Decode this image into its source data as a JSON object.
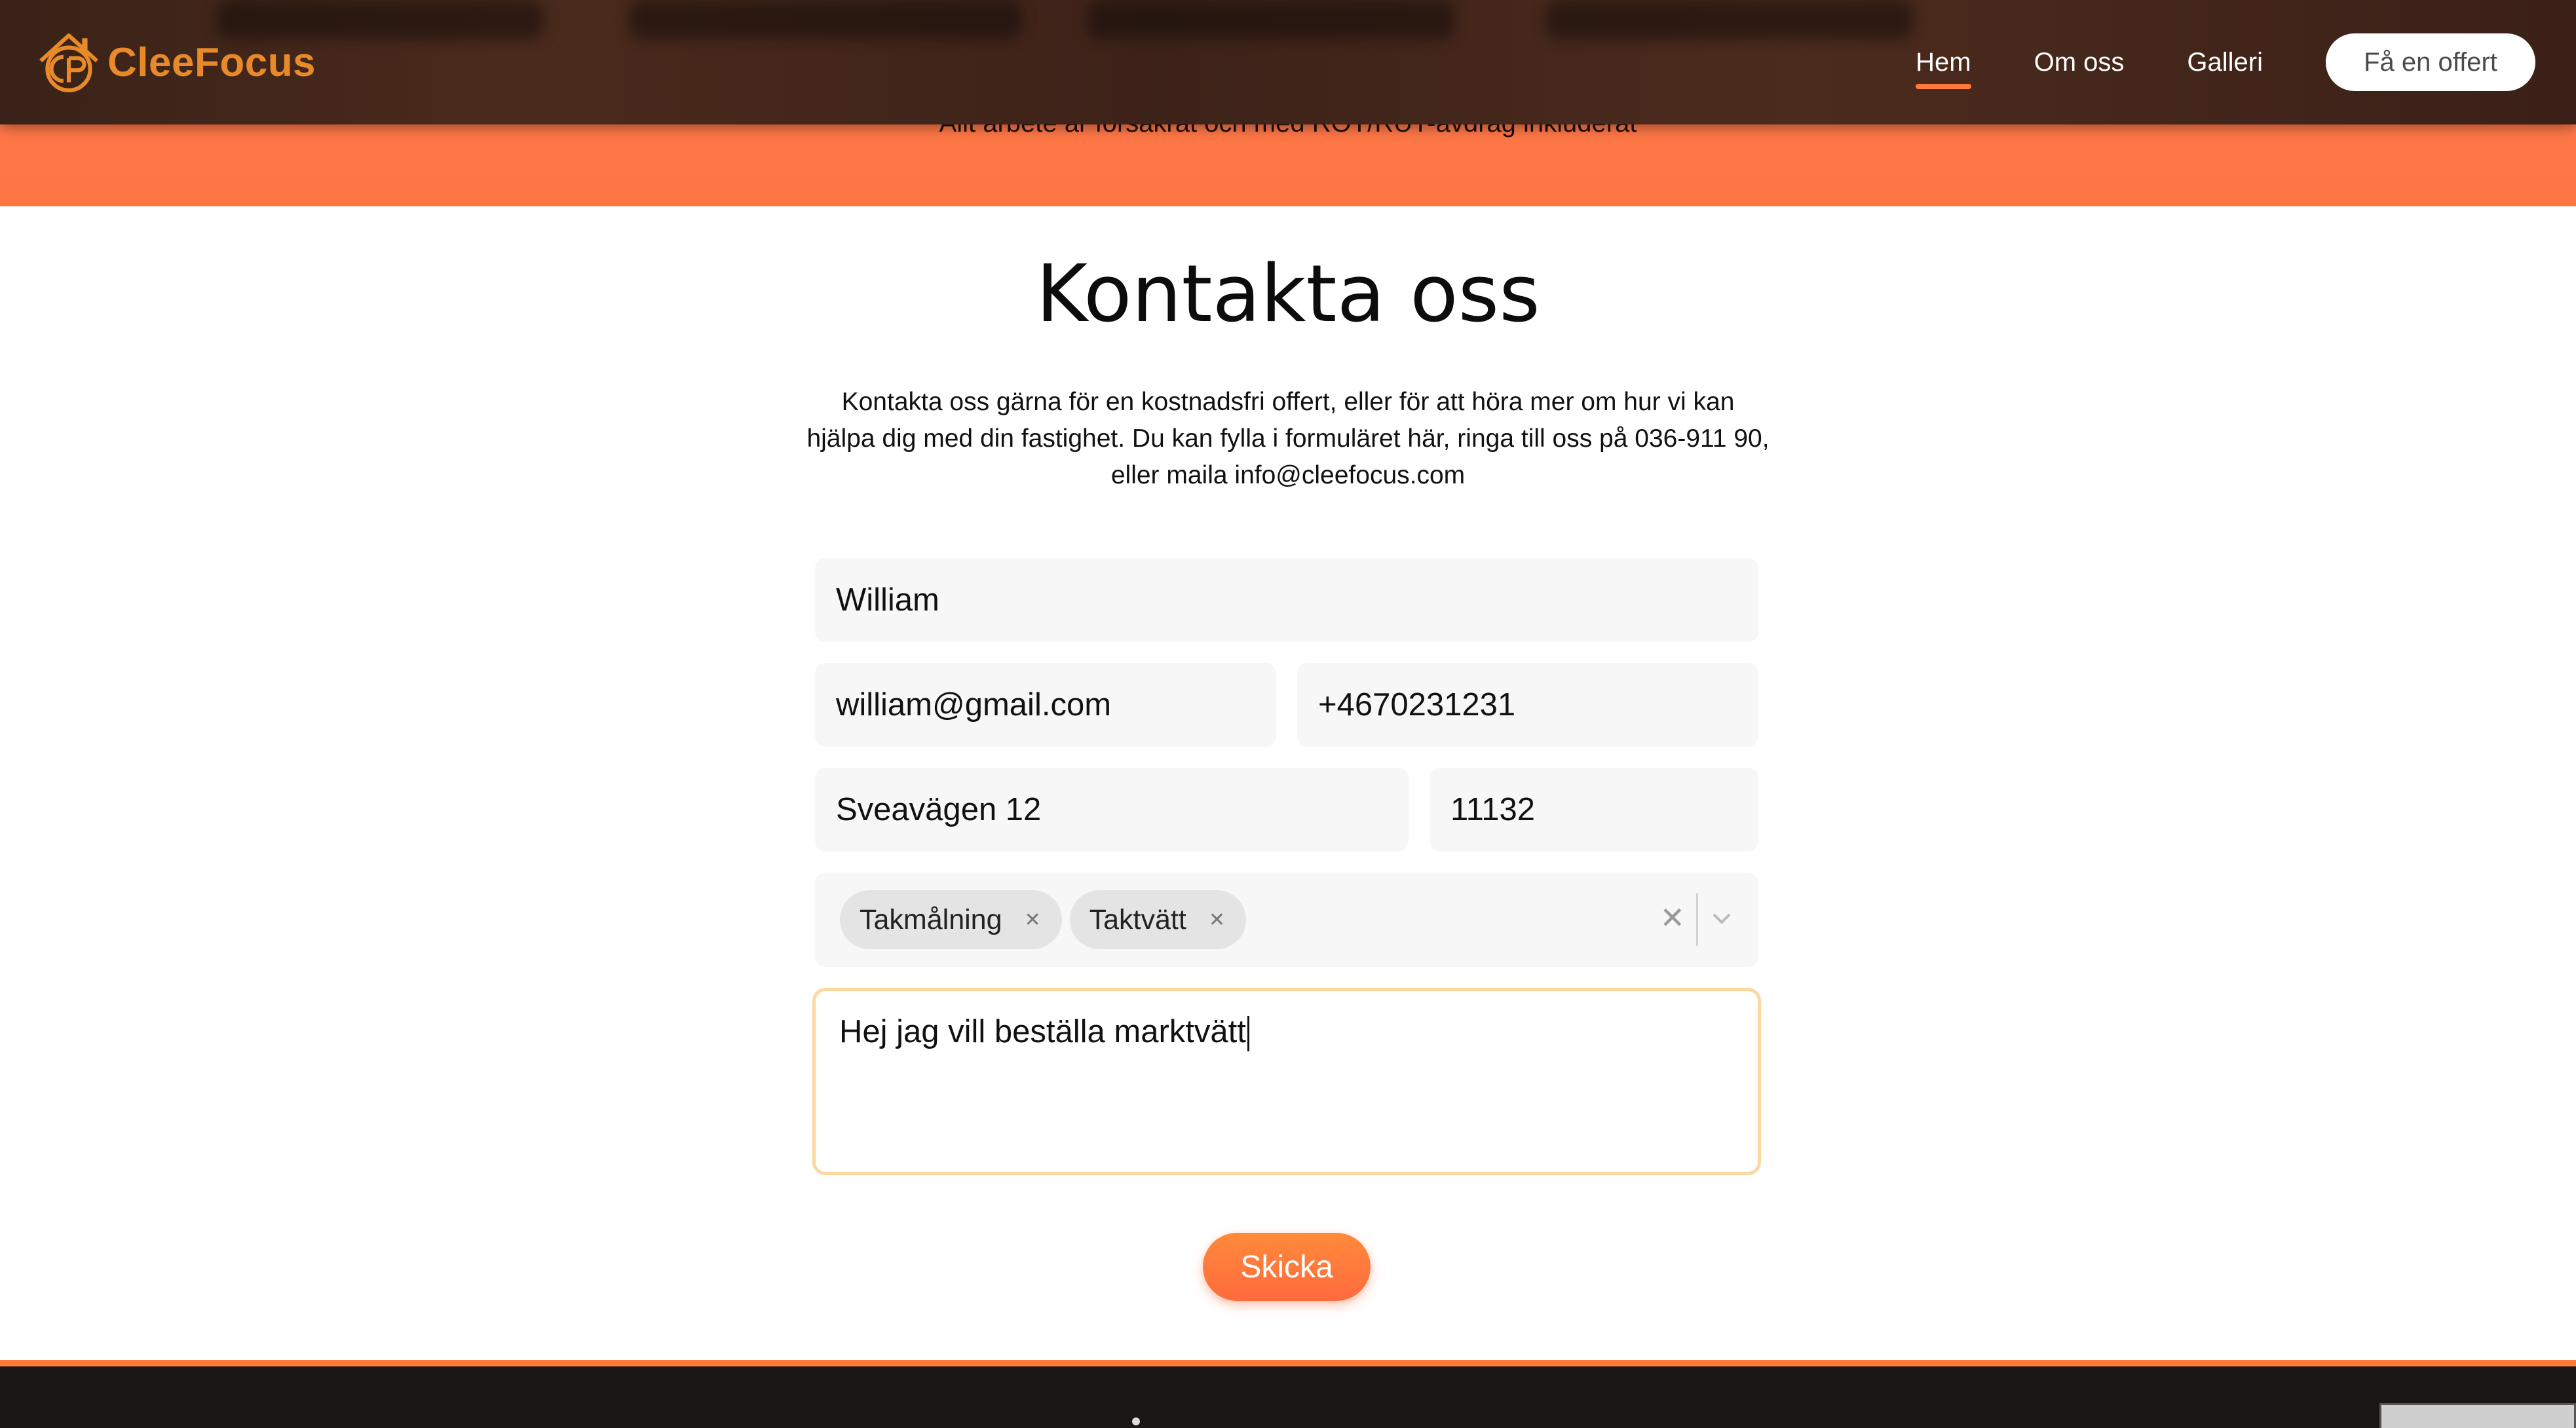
{
  "brand": {
    "name": "CleeFocus",
    "accent": "#e88a2a"
  },
  "nav": {
    "items": [
      {
        "label": "Hem",
        "active": true
      },
      {
        "label": "Om oss",
        "active": false
      },
      {
        "label": "Galleri",
        "active": false
      }
    ],
    "cta": "Få en offert"
  },
  "hero": {
    "text": "Allt arbete är försäkrat och med ROT/RUT-avdrag inkluderat"
  },
  "contact": {
    "title": "Kontakta oss",
    "intro": "Kontakta oss gärna för en kostnadsfri offert, eller för att höra mer om hur vi kan hjälpa dig med din fastighet. Du kan fylla i formuläret här, ringa till oss på 036-911 90, eller maila info@cleefocus.com",
    "fields": {
      "name": "William",
      "email": "william@gmail.com",
      "phone": "+4670231231",
      "street": "Sveavägen 12",
      "zip": "11132"
    },
    "services": [
      "Takmålning",
      "Taktvätt"
    ],
    "message": "Hej jag vill beställa marktvätt",
    "submit": "Skicka"
  },
  "colors": {
    "hero": "#ff7a4a",
    "header": "#3d2219",
    "footer": "#191616",
    "button": "#ff7a3a"
  }
}
